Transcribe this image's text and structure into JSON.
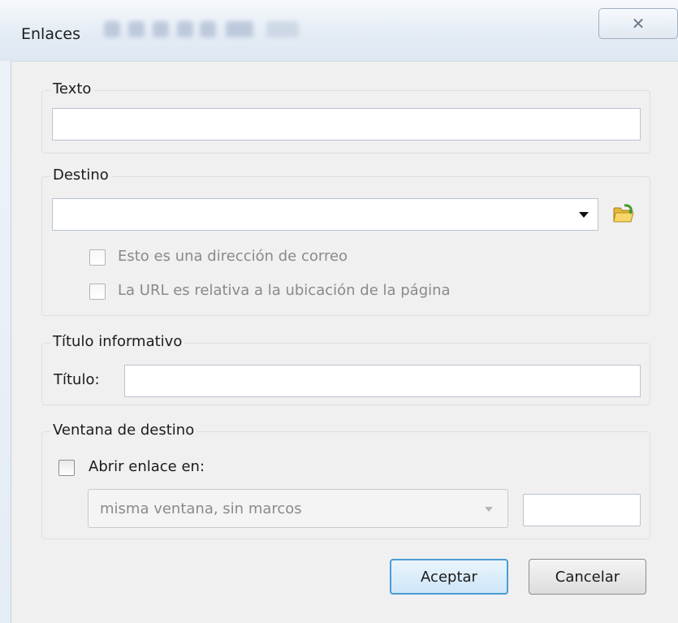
{
  "window": {
    "title": "Enlaces",
    "close_glyph": "✕"
  },
  "texto_group": {
    "label": "Texto",
    "value": ""
  },
  "destino_group": {
    "label": "Destino",
    "value": "",
    "browse_icon": "folder-open-icon",
    "checkbox_email": "Esto es una dirección de correo",
    "checkbox_relative": "La URL es relativa a la ubicación de la página"
  },
  "titulo_group": {
    "label": "Título informativo",
    "field_label": "Título:",
    "value": ""
  },
  "ventana_group": {
    "label": "Ventana de destino",
    "checkbox_label": "Abrir enlace en:",
    "select_value": "misma ventana, sin marcos",
    "frame_value": ""
  },
  "buttons": {
    "ok": "Aceptar",
    "cancel": "Cancelar"
  },
  "colors": {
    "default_button_border": "#4c9bd6",
    "dialog_bg": "#f0f0f0"
  }
}
